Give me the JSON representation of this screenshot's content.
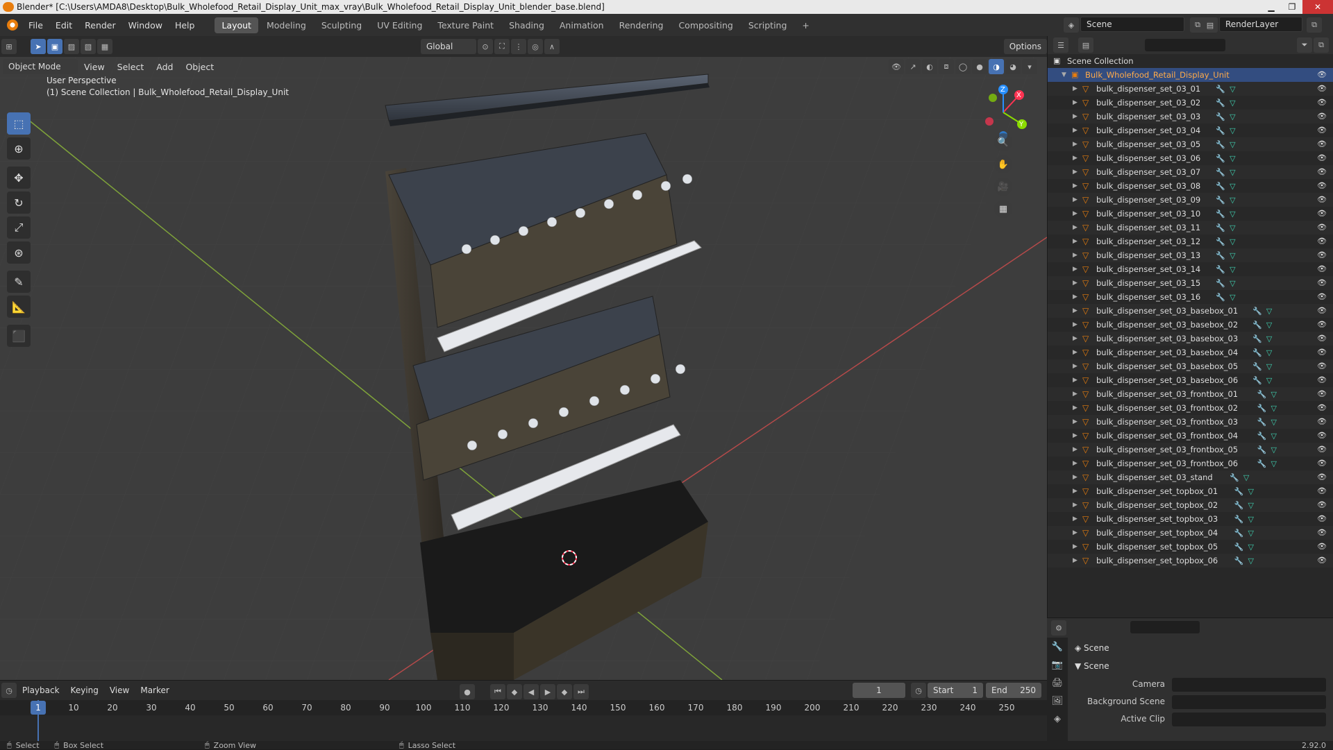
{
  "window": {
    "title": "Blender* [C:\\Users\\AMDA8\\Desktop\\Bulk_Wholefood_Retail_Display_Unit_max_vray\\Bulk_Wholefood_Retail_Display_Unit_blender_base.blend]"
  },
  "menus": [
    "File",
    "Edit",
    "Render",
    "Window",
    "Help"
  ],
  "workspaces": [
    "Layout",
    "Modeling",
    "Sculpting",
    "UV Editing",
    "Texture Paint",
    "Shading",
    "Animation",
    "Rendering",
    "Compositing",
    "Scripting"
  ],
  "active_workspace": "Layout",
  "scene_name": "Scene",
  "render_layer": "RenderLayer",
  "header3d": {
    "transform_orientation": "Global",
    "options_label": "Options",
    "mode": "Object Mode",
    "view_menu": [
      "View",
      "Select",
      "Add",
      "Object"
    ]
  },
  "viewport": {
    "perspective": "User Perspective",
    "collection_info": "(1) Scene Collection | Bulk_Wholefood_Retail_Display_Unit",
    "gizmo_axes": [
      "X",
      "Y",
      "Z"
    ]
  },
  "outliner": {
    "root": "Scene Collection",
    "collection": "Bulk_Wholefood_Retail_Display_Unit",
    "objects": [
      "bulk_dispenser_set_03_01",
      "bulk_dispenser_set_03_02",
      "bulk_dispenser_set_03_03",
      "bulk_dispenser_set_03_04",
      "bulk_dispenser_set_03_05",
      "bulk_dispenser_set_03_06",
      "bulk_dispenser_set_03_07",
      "bulk_dispenser_set_03_08",
      "bulk_dispenser_set_03_09",
      "bulk_dispenser_set_03_10",
      "bulk_dispenser_set_03_11",
      "bulk_dispenser_set_03_12",
      "bulk_dispenser_set_03_13",
      "bulk_dispenser_set_03_14",
      "bulk_dispenser_set_03_15",
      "bulk_dispenser_set_03_16",
      "bulk_dispenser_set_03_basebox_01",
      "bulk_dispenser_set_03_basebox_02",
      "bulk_dispenser_set_03_basebox_03",
      "bulk_dispenser_set_03_basebox_04",
      "bulk_dispenser_set_03_basebox_05",
      "bulk_dispenser_set_03_basebox_06",
      "bulk_dispenser_set_03_frontbox_01",
      "bulk_dispenser_set_03_frontbox_02",
      "bulk_dispenser_set_03_frontbox_03",
      "bulk_dispenser_set_03_frontbox_04",
      "bulk_dispenser_set_03_frontbox_05",
      "bulk_dispenser_set_03_frontbox_06",
      "bulk_dispenser_set_03_stand",
      "bulk_dispenser_set_topbox_01",
      "bulk_dispenser_set_topbox_02",
      "bulk_dispenser_set_topbox_03",
      "bulk_dispenser_set_topbox_04",
      "bulk_dispenser_set_topbox_05",
      "bulk_dispenser_set_topbox_06"
    ]
  },
  "properties": {
    "context": "Scene",
    "panel": "Scene",
    "fields": [
      "Camera",
      "Background Scene",
      "Active Clip"
    ]
  },
  "timeline": {
    "menus": [
      "Playback",
      "Keying",
      "View",
      "Marker"
    ],
    "current_frame": "1",
    "start_label": "Start",
    "start": "1",
    "end_label": "End",
    "end": "250",
    "ticks": [
      "10",
      "20",
      "30",
      "40",
      "50",
      "60",
      "70",
      "80",
      "90",
      "100",
      "110",
      "120",
      "130",
      "140",
      "150",
      "160",
      "170",
      "180",
      "190",
      "200",
      "210",
      "220",
      "230",
      "240",
      "250"
    ]
  },
  "statusbar": {
    "items": [
      "Select",
      "Box Select",
      "Zoom View",
      "Lasso Select"
    ],
    "version": "2.92.0"
  },
  "colors": {
    "accent": "#4772b3",
    "blender_orange": "#e87d0d",
    "axis_x": "#ff3352",
    "axis_y": "#8bdc00",
    "axis_z": "#2890ff"
  }
}
